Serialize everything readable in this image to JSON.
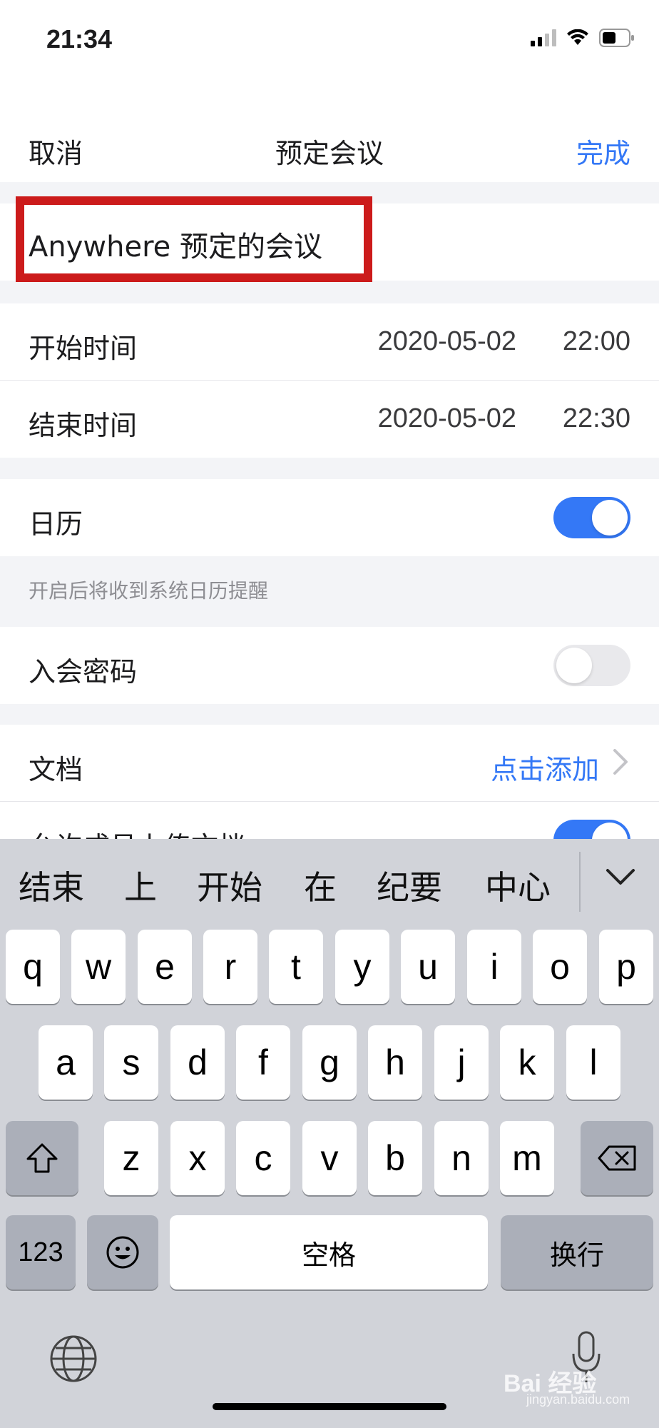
{
  "status_bar": {
    "time": "21:34"
  },
  "nav": {
    "cancel": "取消",
    "title": "预定会议",
    "done": "完成"
  },
  "meeting": {
    "title": "Anywhere 预定的会议"
  },
  "schedule": {
    "start": {
      "label": "开始时间",
      "date": "2020-05-02",
      "time": "22:00"
    },
    "end": {
      "label": "结束时间",
      "date": "2020-05-02",
      "time": "22:30"
    }
  },
  "calendar": {
    "label": "日历",
    "enabled": true,
    "hint": "开启后将收到系统日历提醒"
  },
  "password": {
    "label": "入会密码",
    "enabled": false
  },
  "documents": {
    "label": "文档",
    "action": "点击添加",
    "partial_row_label": "允许成员上传文档",
    "partial_row_enabled": true
  },
  "keyboard": {
    "candidates": [
      "结束",
      "上",
      "开始",
      "在",
      "纪要",
      "中心"
    ],
    "row1": [
      "q",
      "w",
      "e",
      "r",
      "t",
      "y",
      "u",
      "i",
      "o",
      "p"
    ],
    "row2": [
      "a",
      "s",
      "d",
      "f",
      "g",
      "h",
      "j",
      "k",
      "l"
    ],
    "row3": [
      "z",
      "x",
      "c",
      "v",
      "b",
      "n",
      "m"
    ],
    "numbers_key": "123",
    "space_key": "空格",
    "return_key": "换行"
  },
  "watermark": {
    "brand": "Bai 经验",
    "site": "jingyan.baidu.com"
  },
  "colors": {
    "accent": "#3478f6",
    "highlight_border": "#cc1b1b",
    "keyboard_bg": "#d1d3d9"
  }
}
